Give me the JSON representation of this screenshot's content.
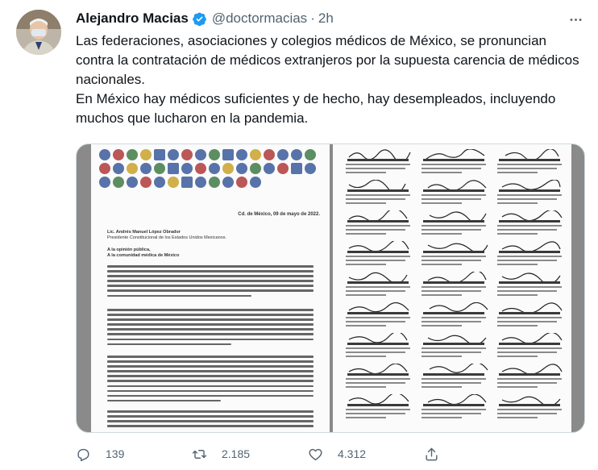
{
  "tweet": {
    "author_name": "Alejandro Macias",
    "handle": "@doctormacias",
    "separator": "·",
    "time": "2h",
    "verified": true,
    "text_paragraphs": [
      "Las federaciones, asociaciones y colegios médicos de México, se pronuncian contra la contratación de médicos extranjeros por la supuesta carencia de médicos nacionales.",
      "En México hay médicos suficientes y de hecho, hay desempleados, incluyendo muchos que lucharon en la pandemia."
    ]
  },
  "media": {
    "letter_date": "Cd. de México, 09 de mayo de 2022.",
    "letter_to_name": "Lic. Andrés Manuel López Obrador",
    "letter_to_title": "Presidente Constitucional de los Estados Unidos Mexicanos.",
    "letter_salute_1": "A la opinión pública,",
    "letter_salute_2": "A la comunidad médica de México"
  },
  "actions": {
    "reply_count": "139",
    "retweet_count": "2.185",
    "like_count": "4.312"
  },
  "icons": {
    "more": "more-icon",
    "reply": "reply-icon",
    "retweet": "retweet-icon",
    "like": "like-icon",
    "share": "share-icon",
    "verified": "verified-badge-icon"
  },
  "colors": {
    "text": "#0f1419",
    "secondary": "#536471",
    "verified_blue": "#1d9bf0",
    "border": "#cfd9de"
  }
}
